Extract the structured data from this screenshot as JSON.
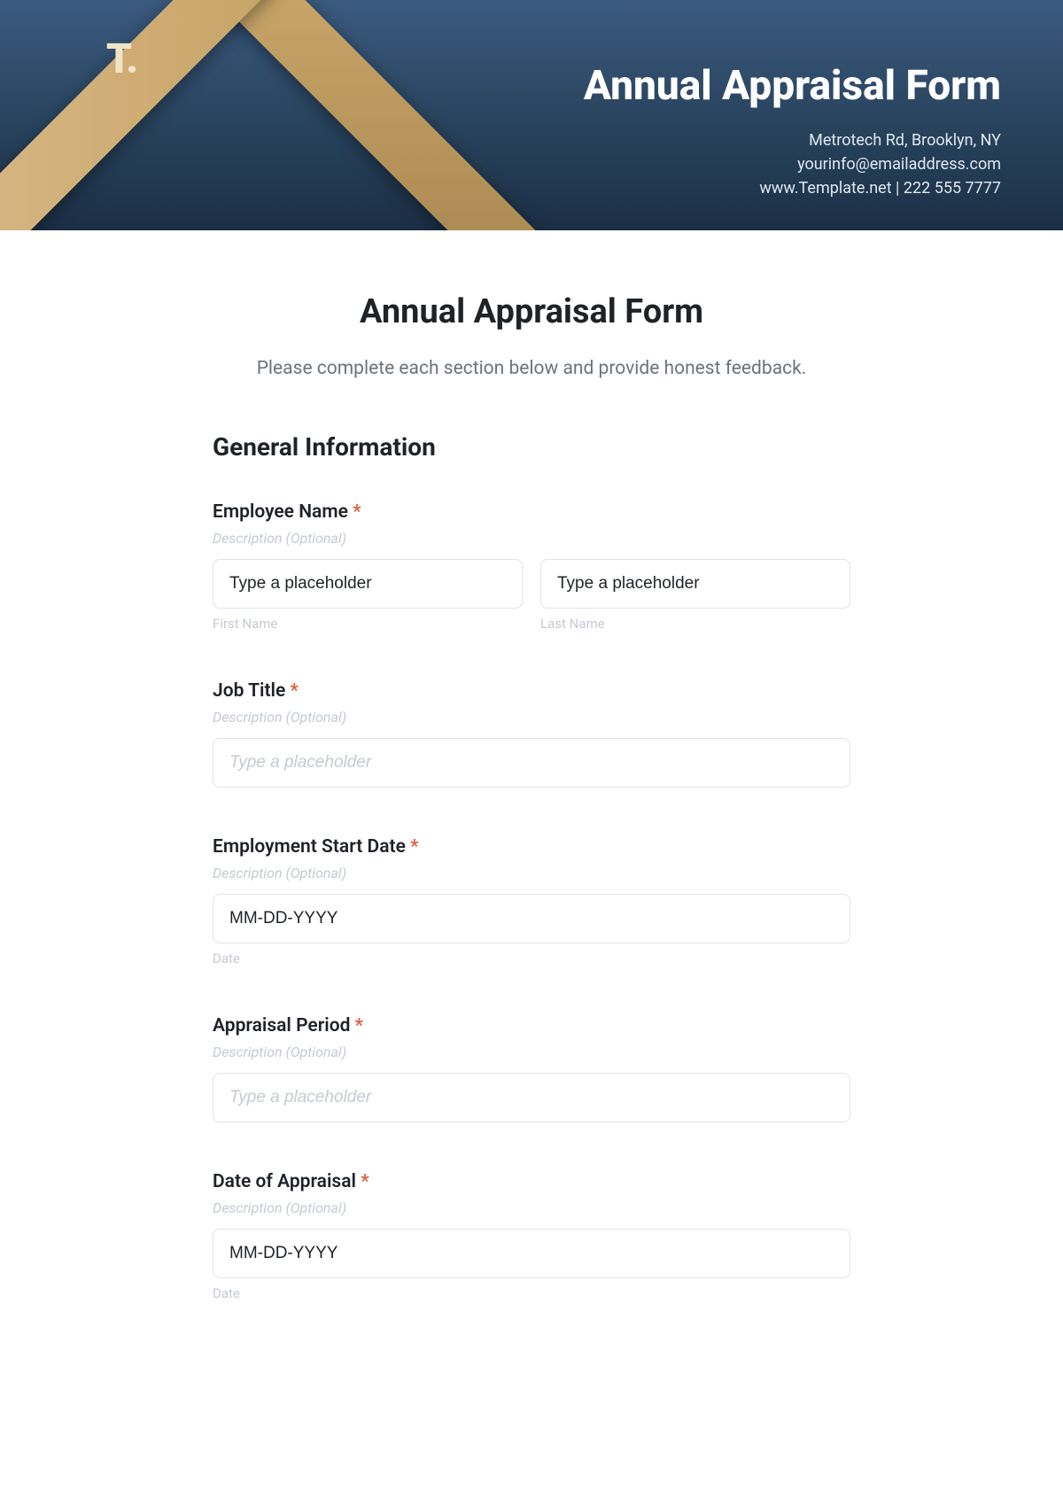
{
  "banner": {
    "logo": "T.",
    "title": "Annual Appraisal Form",
    "contact_line1": "Metrotech Rd, Brooklyn, NY",
    "contact_line2": "yourinfo@emailaddress.com",
    "contact_line3": "www.Template.net  |  222 555 7777"
  },
  "form": {
    "title": "Annual Appraisal Form",
    "subtitle": "Please complete each section below and provide honest feedback.",
    "section_heading": "General Information",
    "description_placeholder": "Description (Optional)",
    "required_mark": "*",
    "fields": {
      "employee_name": {
        "label": "Employee Name",
        "first_placeholder": "Type a placeholder",
        "last_placeholder": "Type a placeholder",
        "first_sublabel": "First Name",
        "last_sublabel": "Last Name"
      },
      "job_title": {
        "label": "Job Title",
        "placeholder": "Type a placeholder"
      },
      "employment_start_date": {
        "label": "Employment Start Date",
        "placeholder": "MM-DD-YYYY",
        "sublabel": "Date"
      },
      "appraisal_period": {
        "label": "Appraisal Period",
        "placeholder": "Type a placeholder"
      },
      "date_of_appraisal": {
        "label": "Date of Appraisal",
        "placeholder": "MM-DD-YYYY",
        "sublabel": "Date"
      }
    }
  }
}
